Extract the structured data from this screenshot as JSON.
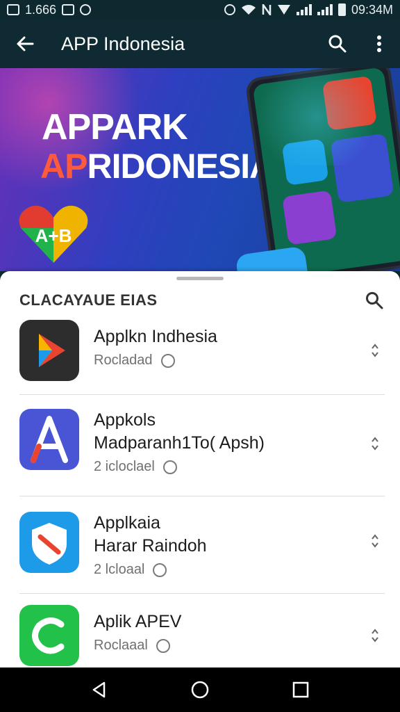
{
  "status_bar": {
    "left_text": "1.666",
    "time": "09:34M",
    "icons": [
      "photo-icon",
      "save-icon",
      "bubble-icon",
      "alarm-icon",
      "wifi-icon",
      "nfc-icon",
      "signal-icon",
      "signal-icon",
      "battery-icon"
    ]
  },
  "app_bar": {
    "title": "APP Indonesia",
    "back_icon": "arrow-left-icon",
    "search_icon": "search-icon",
    "more_icon": "more-vert-icon"
  },
  "hero": {
    "line1": "APPARK",
    "line2_prefix": "AP",
    "line2_rest": "RIDONESIA",
    "logo_text": "A+B"
  },
  "sheet": {
    "title": "CLACAYAUE EIAS",
    "search_icon": "search-icon"
  },
  "apps": [
    {
      "name_lines": [
        "Applkn Indhesia"
      ],
      "meta": "Rocladad",
      "icon": "play-diamond-icon",
      "icon_color": "#2d2d2d"
    },
    {
      "name_lines": [
        "Appkols",
        "Madparanh1To( Apsh)"
      ],
      "meta": "2 icloclael",
      "icon": "letter-a-icon",
      "icon_color": "#4a55d6"
    },
    {
      "name_lines": [
        "Applkaia",
        "Harar Raindoh"
      ],
      "meta": "2 lcloaal",
      "icon": "shield-icon",
      "icon_color": "#1e9be8"
    },
    {
      "name_lines": [
        "Aplik APEV"
      ],
      "meta": "Roclaaal",
      "icon": "c-leaf-icon",
      "icon_color": "#22c24a"
    }
  ],
  "nav": {
    "back_icon": "nav-back-icon",
    "home_icon": "nav-home-icon",
    "recents_icon": "nav-recents-icon"
  }
}
